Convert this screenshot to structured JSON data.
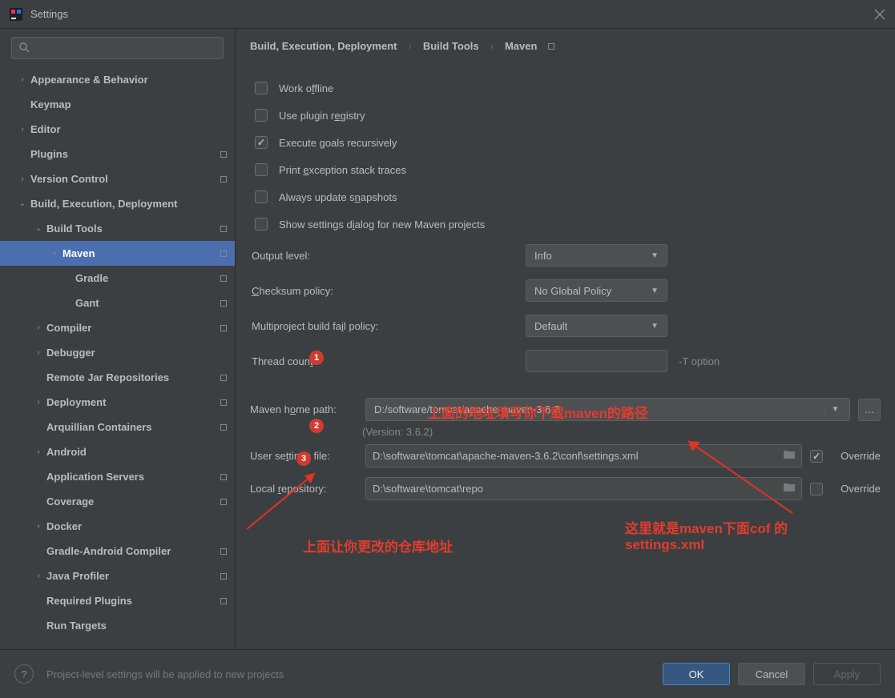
{
  "titlebar": {
    "title": "Settings"
  },
  "sidebar": {
    "search_placeholder": "",
    "items": [
      {
        "label": "Appearance & Behavior",
        "chev": "›"
      },
      {
        "label": "Keymap",
        "chev": ""
      },
      {
        "label": "Editor",
        "chev": "›"
      },
      {
        "label": "Plugins",
        "chev": "",
        "marker": true
      },
      {
        "label": "Version Control",
        "chev": "›",
        "marker": true
      },
      {
        "label": "Build, Execution, Deployment",
        "chev": "⌄"
      },
      {
        "label": "Build Tools",
        "chev": "⌄",
        "marker": true,
        "indent": 1
      },
      {
        "label": "Maven",
        "chev": "›",
        "marker": true,
        "indent": 2,
        "selected": true
      },
      {
        "label": "Gradle",
        "chev": "",
        "marker": true,
        "indent": 3
      },
      {
        "label": "Gant",
        "chev": "",
        "marker": true,
        "indent": 3
      },
      {
        "label": "Compiler",
        "chev": "›",
        "marker": true,
        "indent": 1
      },
      {
        "label": "Debugger",
        "chev": "›",
        "indent": 1
      },
      {
        "label": "Remote Jar Repositories",
        "chev": "",
        "marker": true,
        "indent": 1
      },
      {
        "label": "Deployment",
        "chev": "›",
        "marker": true,
        "indent": 1
      },
      {
        "label": "Arquillian Containers",
        "chev": "",
        "marker": true,
        "indent": 1
      },
      {
        "label": "Android",
        "chev": "›",
        "indent": 1
      },
      {
        "label": "Application Servers",
        "chev": "",
        "marker": true,
        "indent": 1
      },
      {
        "label": "Coverage",
        "chev": "",
        "marker": true,
        "indent": 1
      },
      {
        "label": "Docker",
        "chev": "›",
        "indent": 1
      },
      {
        "label": "Gradle-Android Compiler",
        "chev": "",
        "marker": true,
        "indent": 1
      },
      {
        "label": "Java Profiler",
        "chev": "›",
        "marker": true,
        "indent": 1
      },
      {
        "label": "Required Plugins",
        "chev": "",
        "marker": true,
        "indent": 1
      },
      {
        "label": "Run Targets",
        "chev": "",
        "indent": 1
      }
    ]
  },
  "breadcrumb": {
    "a": "Build, Execution, Deployment",
    "b": "Build Tools",
    "c": "Maven",
    "sep": "›"
  },
  "checkboxes": {
    "work_offline": "Work offline",
    "use_plugin_registry": "Use plugin registry",
    "execute_goals": "Execute goals recursively",
    "print_exception": "Print exception stack traces",
    "always_update": "Always update snapshots",
    "show_settings": "Show settings dialog for new Maven projects"
  },
  "form": {
    "output_level": {
      "label": "Output level:",
      "value": "Info"
    },
    "checksum_policy": {
      "label": "Checksum policy:",
      "value": "No Global Policy"
    },
    "fail_policy": {
      "label": "Multiproject build fail policy:",
      "value": "Default"
    },
    "thread_count": {
      "label": "Thread count",
      "hint": "-T option",
      "value": ""
    },
    "maven_home": {
      "label": "Maven home path:",
      "value": "D:/software/tomcat/apache-maven-3.6.2"
    },
    "version": "(Version: 3.6.2)",
    "user_settings": {
      "label": "User settings file:",
      "value": "D:\\software\\tomcat\\apache-maven-3.6.2\\conf\\settings.xml",
      "override": "Override",
      "checked": true
    },
    "local_repo": {
      "label": "Local repository:",
      "value": "D:\\software\\tomcat\\repo",
      "override": "Override",
      "checked": false
    }
  },
  "annotations": {
    "b1": "1",
    "b2": "2",
    "b3": "3",
    "t1": "上面的地址填写你下载maven的路径",
    "t2": "上面让你更改的仓库地址",
    "t3a": "这里就是maven下面cof 的",
    "t3b": "settings.xml"
  },
  "footer": {
    "help": "?",
    "text": "Project-level settings will be applied to new projects",
    "ok": "OK",
    "cancel": "Cancel",
    "apply": "Apply"
  }
}
